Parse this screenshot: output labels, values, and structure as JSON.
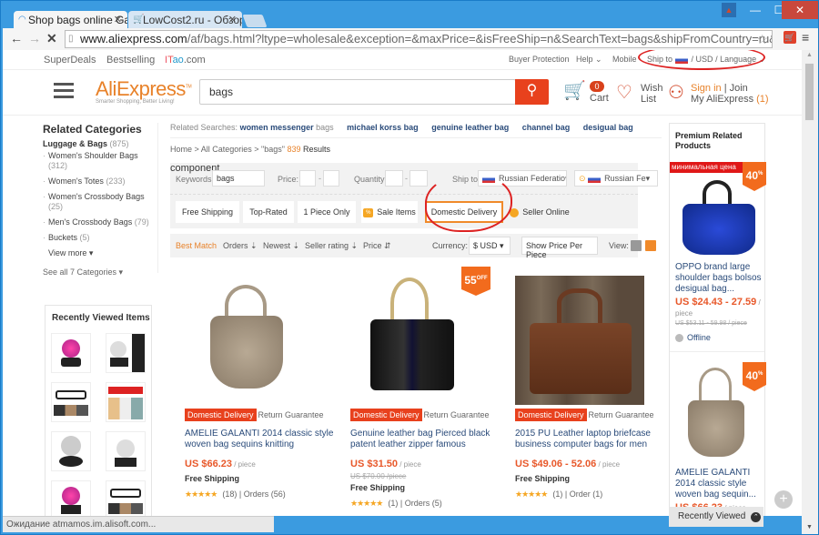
{
  "browser": {
    "tabs": [
      {
        "title": "Shop bags online Ga",
        "active": true,
        "icon": "loading-spinner-icon"
      },
      {
        "title": "LowCost2.ru - Обзор",
        "active": false,
        "icon": "cart-favicon-icon"
      }
    ],
    "url_host": "www.aliexpress.com",
    "url_path": "/af/bags.html?ltype=wholesale&exception=&maxPrice=&isFreeShip=n&SearchText=bags&shipFromCountry=ru&isUnitPrice=&isFavorite=r",
    "status_text": "Ожидание atmamos.im.alisoft.com..."
  },
  "topnav": {
    "left": [
      "SuperDeals",
      "Bestselling"
    ],
    "itao": {
      "i": "I",
      "t": "T",
      "ao": "ao",
      "com": ".com"
    },
    "right": {
      "buyer_protection": "Buyer Protection",
      "help": "Help",
      "mobile": "Mobile",
      "ship_to": "Ship to",
      "currency": "/ USD",
      "language": "/ Language"
    }
  },
  "header": {
    "logo": "AliExpress",
    "logo_tm": "TM",
    "tagline": "Smarter Shopping, Better Living!",
    "search_value": "bags",
    "cart_count": "0",
    "cart_label": "Cart",
    "wish_line1": "Wish",
    "wish_line2": "List",
    "sign_in": "Sign in",
    "join": "| Join",
    "my_ali": "My AliExpress",
    "my_ali_count": "(1)"
  },
  "sidebar": {
    "title": "Related Categories",
    "main": {
      "label": "Luggage & Bags",
      "count": "(875)"
    },
    "items": [
      {
        "label": "Women's Shoulder Bags",
        "count": "(312)"
      },
      {
        "label": "Women's Totes",
        "count": "(233)"
      },
      {
        "label": "Women's Crossbody Bags",
        "count": "(25)"
      },
      {
        "label": "Men's Crossbody Bags",
        "count": "(79)"
      },
      {
        "label": "Buckets",
        "count": "(5)"
      }
    ],
    "view_more": "View more ▾",
    "see_all": "See all 7 Categories ▾",
    "recent_title": "Recently Viewed Items"
  },
  "related": {
    "label": "Related Searches:",
    "links": [
      {
        "bold": "women messenger",
        "rest": " bags"
      },
      {
        "bold": "michael korss bag",
        "rest": ""
      },
      {
        "bold": "genuine leather bag",
        "rest": ""
      },
      {
        "bold": "channel bag",
        "rest": ""
      },
      {
        "bold": "desigual bag",
        "rest": ""
      }
    ]
  },
  "breadcrumb": {
    "path": "Home > All Categories > \"bags\"",
    "count": "839",
    "results": "Results"
  },
  "filters": {
    "keywords_label": "Keywords:",
    "keywords_value": "bags",
    "price_label": "Price:",
    "quantity_label": "Quantity:",
    "ship_to_label": "Ship to",
    "ship_to_value": "Russian Federatio▾",
    "ship_from_value": "Russian Fe▾",
    "buttons": [
      "Free Shipping",
      "Top-Rated",
      "1 Piece Only",
      "Sale Items",
      "Domestic Delivery",
      "Seller Online"
    ]
  },
  "sort": {
    "options": [
      "Best Match",
      "Orders ⇣",
      "Newest ⇣",
      "Seller rating ⇣",
      "Price ⇵"
    ],
    "currency_label": "Currency:",
    "currency_value": "$ USD  ▾",
    "price_per_piece": "Show Price Per Piece",
    "view_label": "View:",
    "accent": "#e8822a"
  },
  "products": [
    {
      "tag1": "Domestic Delivery",
      "tag2": "Return Guarantee",
      "title": "AMELIE GALANTI 2014 classic style woven bag sequins knitting",
      "price": "US $66.23",
      "unit": " / piece",
      "old_price": "",
      "shipping": "Free Shipping",
      "stars": "★★★★★",
      "reviews": "(18)",
      "orders": "| Orders (56)",
      "discount": ""
    },
    {
      "tag1": "Domestic Delivery",
      "tag2": "Return Guarantee",
      "title": "Genuine leather bag Pierced black patent leather zipper famous",
      "price": "US $31.50",
      "unit": " / piece",
      "old_price": "US $70.00 /piece",
      "shipping": "Free Shipping",
      "stars": "★★★★★",
      "reviews": "(1)",
      "orders": "| Orders (5)",
      "discount": "55"
    },
    {
      "tag1": "Domestic Delivery",
      "tag2": "Return Guarantee",
      "title": "2015 PU Leather laptop briefcase business computer bags for men",
      "price": "US $49.06 - 52.06",
      "unit": " / piece",
      "old_price": "",
      "shipping": "Free Shipping",
      "stars": "★★★★★",
      "reviews": "(1)",
      "orders": "| Order (1)",
      "discount": ""
    }
  ],
  "premium": {
    "title": "Premium Related Products",
    "items": [
      {
        "banner": "минимальная цена",
        "discount": "40",
        "title": "OPPO brand large shoulder bags bolsos desigual bag...",
        "price": "US $24.43 - 27.59",
        "unit": " /",
        "unit2": "piece",
        "old_price": "US $53.11 - 59.98 / piece",
        "status": "Offline"
      },
      {
        "discount": "40",
        "title": "AMELIE GALANTI 2014 classic style woven bag sequin...",
        "price": "US $66.23",
        "unit": " / piece"
      }
    ],
    "recently_viewed": "Recently Viewed"
  },
  "discount_off": "OFF",
  "colors": {
    "brand": "#e8411d",
    "orange": "#e8822a",
    "link": "#2a4b7a",
    "annotation": "#dd2222"
  }
}
